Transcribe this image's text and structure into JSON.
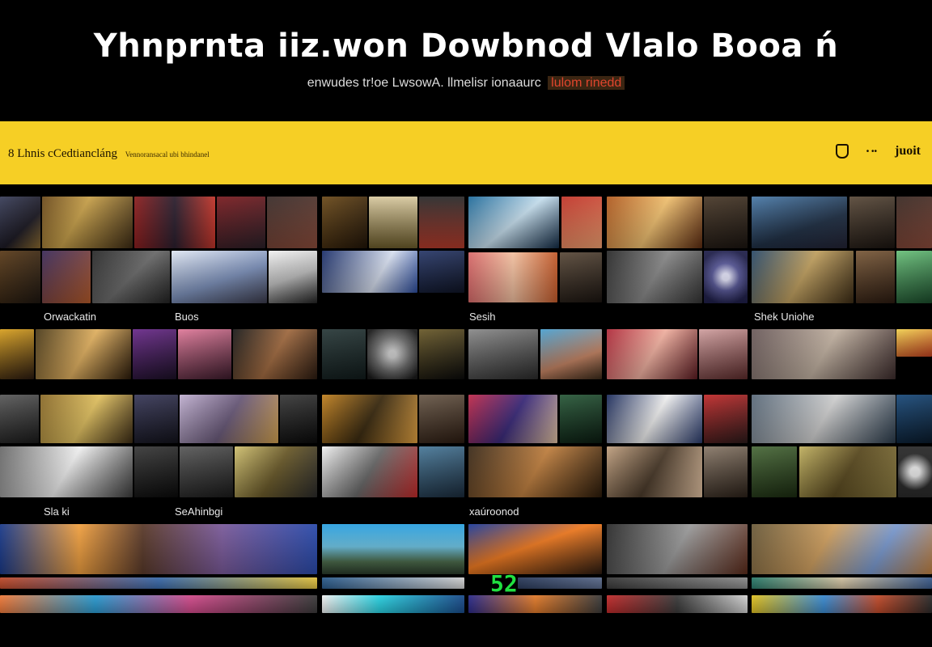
{
  "header": {
    "title": "Yhnprnta iiz.won Dowbnod  Vlalo Booa ń",
    "subtitle": "enwudes tr!oe LwsowA. llmelisr ionaaurc",
    "subtitle_accent": "lulom rinedd"
  },
  "banner": {
    "left_text": "8 Lhnis cCedtiancláng",
    "left_small": "Vennoransacal ubi bhindanel",
    "right_dots": "• ••",
    "right_link": "juoit"
  },
  "sections": {
    "row1_a": "Orwackatin",
    "row1_b": "Buos",
    "row1_c": "Sesih",
    "row1_d": "Shek Uniohe",
    "row2_a": "Sla ki",
    "row2_b": "SeAhinbgi",
    "row2_c": "xaúroonod"
  },
  "badge": "52",
  "colors": {
    "background": "#000000",
    "banner": "#f6cf25",
    "accent_red": "#e0452d",
    "badge_green": "#20e040"
  }
}
